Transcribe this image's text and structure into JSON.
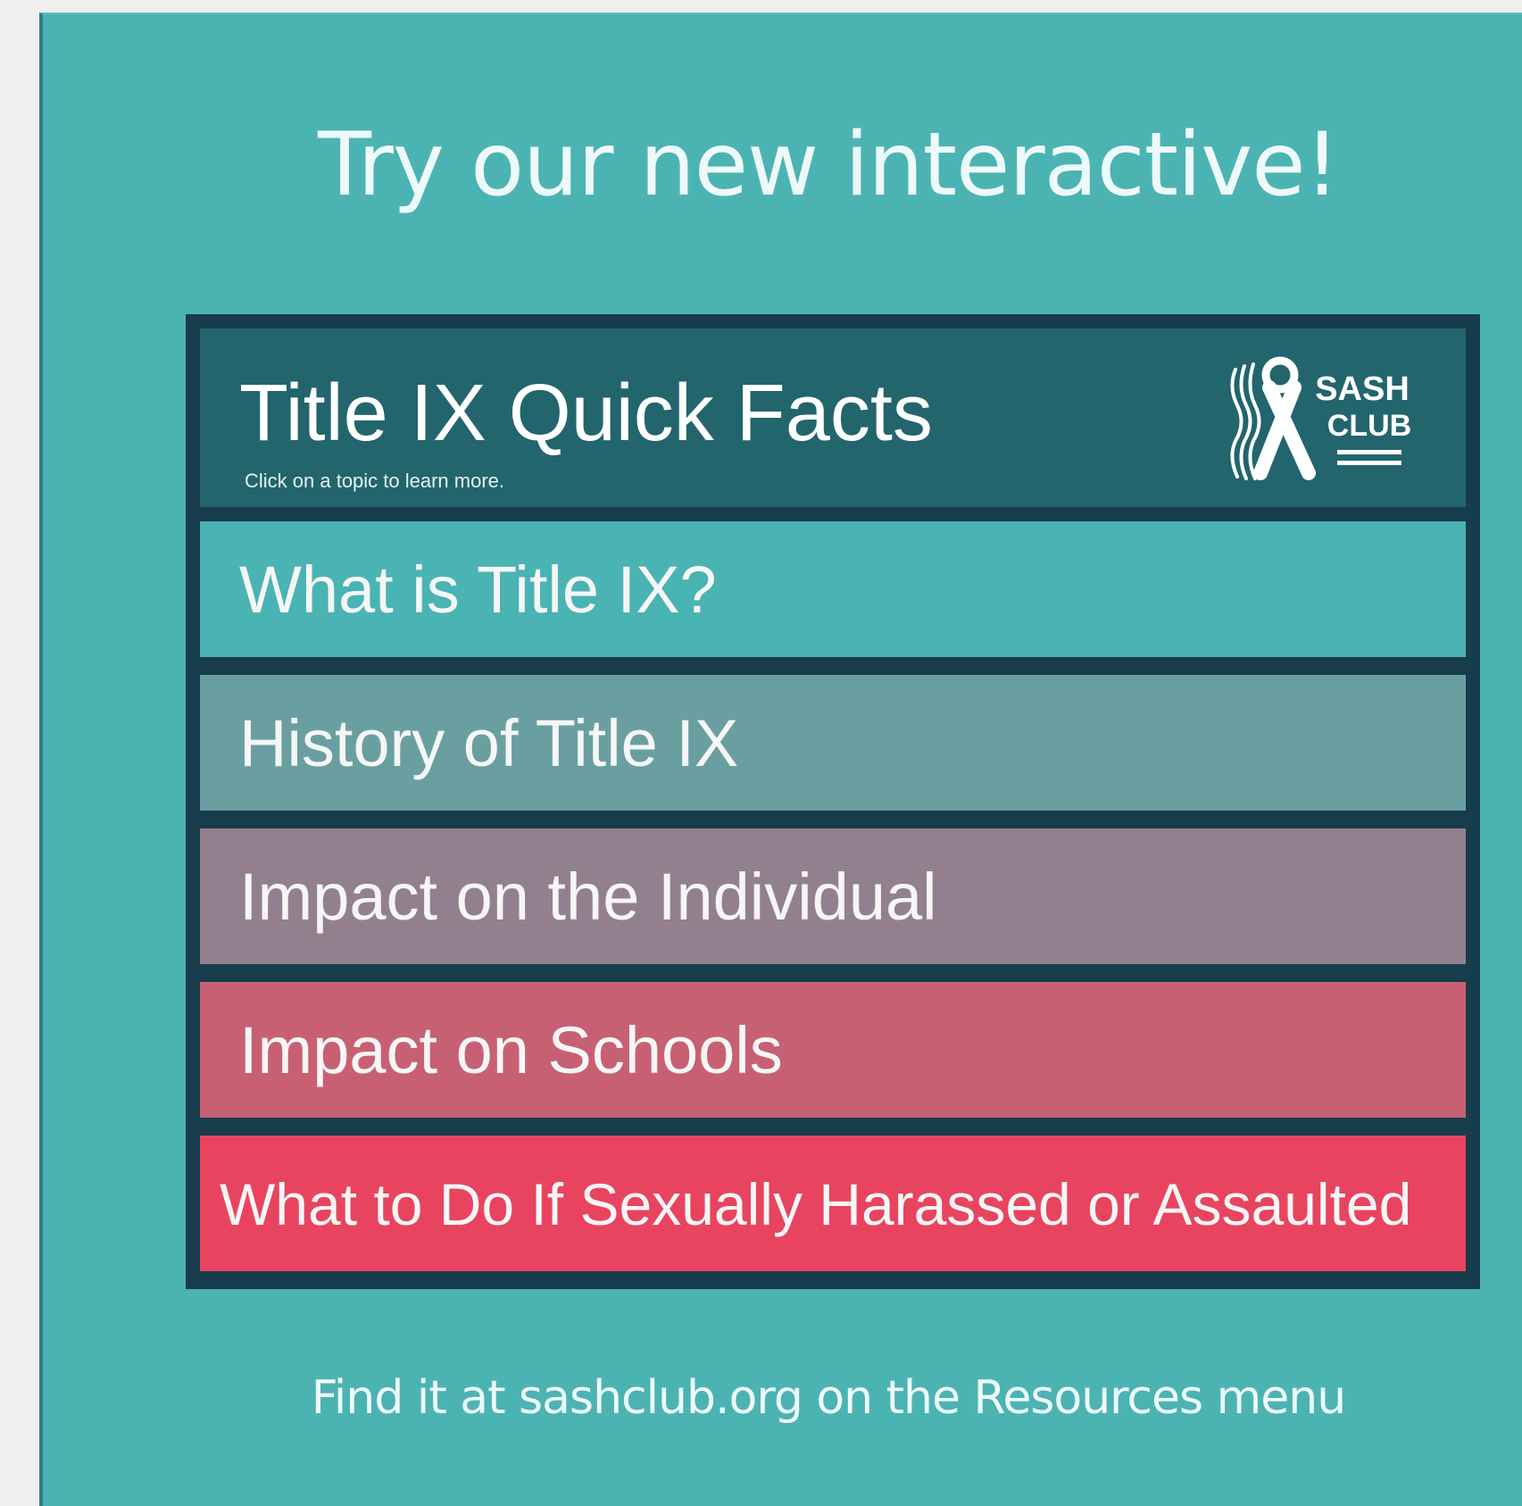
{
  "headline": "Try our new interactive!",
  "widget": {
    "title": "Title IX Quick Facts",
    "subtitle": "Click on a topic to learn more.",
    "logo": {
      "icon": "awareness-ribbon-icon",
      "line1": "SASH",
      "line2": "CLUB"
    },
    "topics": [
      {
        "label": "What is Title IX?",
        "color": "#4ab3b4"
      },
      {
        "label": "History of Title IX",
        "color": "#6a9fa1"
      },
      {
        "label": "Impact on the Individual",
        "color": "#93808e"
      },
      {
        "label": "Impact on Schools",
        "color": "#c86073"
      },
      {
        "label": "What to Do If Sexually Harassed or Assaulted",
        "color": "#e8445f"
      }
    ]
  },
  "footer": "Find it at sashclub.org  on the Resources menu",
  "colors": {
    "background": "#4cb3b3",
    "widget_frame": "#173c4b",
    "header": "#22656d"
  }
}
